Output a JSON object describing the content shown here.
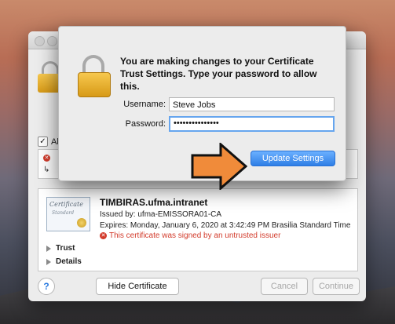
{
  "dialog": {
    "message": "You are making changes to your Certificate Trust Settings. Type your password to allow this.",
    "username_label": "Username:",
    "username_value": "Steve Jobs",
    "password_label": "Password:",
    "password_value": "•••••••••••••••",
    "update_button": "Update Settings"
  },
  "sheet": {
    "always_trust_label": "Alw",
    "cert_image_text": "Certificate",
    "cert_image_subtext": "Standard",
    "cert_name": "TIMBIRAS.ufma.intranet",
    "issued_by": "Issued by: ufma-EMISSORA01-CA",
    "expires": "Expires: Monday, January 6, 2020 at 3:42:49 PM Brasilia Standard Time",
    "error": "This certificate was signed by an untrusted issuer",
    "trust_label": "Trust",
    "details_label": "Details",
    "help_label": "?",
    "hide_button": "Hide Certificate",
    "cancel_button": "Cancel",
    "continue_button": "Continue"
  },
  "colors": {
    "accent": "#2f7fe6",
    "error": "#d23a2a",
    "arrow": "#f08b3a"
  },
  "icons": [
    "lock-icon",
    "checkbox-icon",
    "error-icon",
    "disclosure-icon",
    "help-icon",
    "arrow-icon"
  ]
}
